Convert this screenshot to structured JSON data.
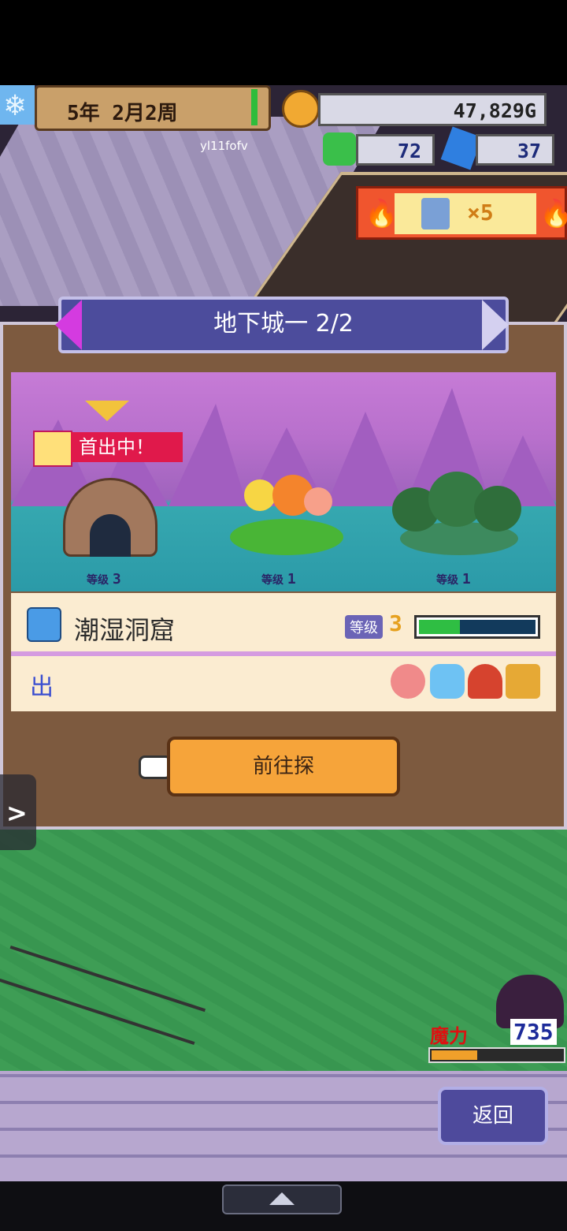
{
  "hud": {
    "date": "5年  2月2周",
    "username": "yl11fofv",
    "gold": "47,829G",
    "monsters": "72",
    "crystals": "37",
    "party_multiplier": "×5"
  },
  "dungeon": {
    "title": "地下城一 2/2",
    "first_out_badge": "首出中！",
    "level_label": "等级",
    "locations": [
      {
        "level": "3"
      },
      {
        "level": "1"
      },
      {
        "level": "1"
      }
    ],
    "selected_name": "潮湿洞窟",
    "selected_level_label": "等级",
    "selected_level": "3",
    "progress": 0.35,
    "appear_label": "出",
    "go_button": "前往探"
  },
  "mana": {
    "label": "魔力",
    "value": "735",
    "fill": 0.35
  },
  "back_button": "返回",
  "colors": {
    "panel_bg": "#7d5a3f",
    "title_bg": "#4c4c9c",
    "go_button": "#f6a43a",
    "progress_green": "#2fbe43",
    "badge_red": "#e0194b"
  }
}
